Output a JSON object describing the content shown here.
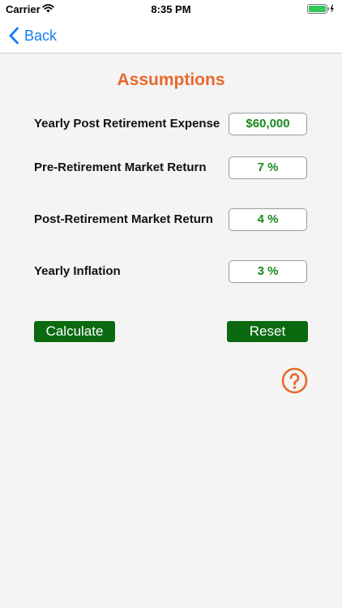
{
  "status_bar": {
    "carrier": "Carrier",
    "time": "8:35 PM",
    "icons": [
      "wifi-icon",
      "battery-icon"
    ]
  },
  "nav": {
    "back_label": "Back",
    "back_icon": "chevron-left-icon"
  },
  "page": {
    "title": "Assumptions"
  },
  "fields": [
    {
      "label": "Yearly Post Retirement Expense",
      "value": "$60,000"
    },
    {
      "label": "Pre-Retirement Market Return",
      "value": "7 %"
    },
    {
      "label": "Post-Retirement Market Return",
      "value": "4 %"
    },
    {
      "label": "Yearly Inflation",
      "value": "3 %"
    }
  ],
  "buttons": {
    "calculate": "Calculate",
    "reset": "Reset"
  },
  "help_icon": "question-circle-icon",
  "colors": {
    "accent": "#e8692c",
    "link": "#1a7cf5",
    "value_text": "#168a1c",
    "button_bg": "#0b6a10",
    "background": "#f4f4f4"
  }
}
